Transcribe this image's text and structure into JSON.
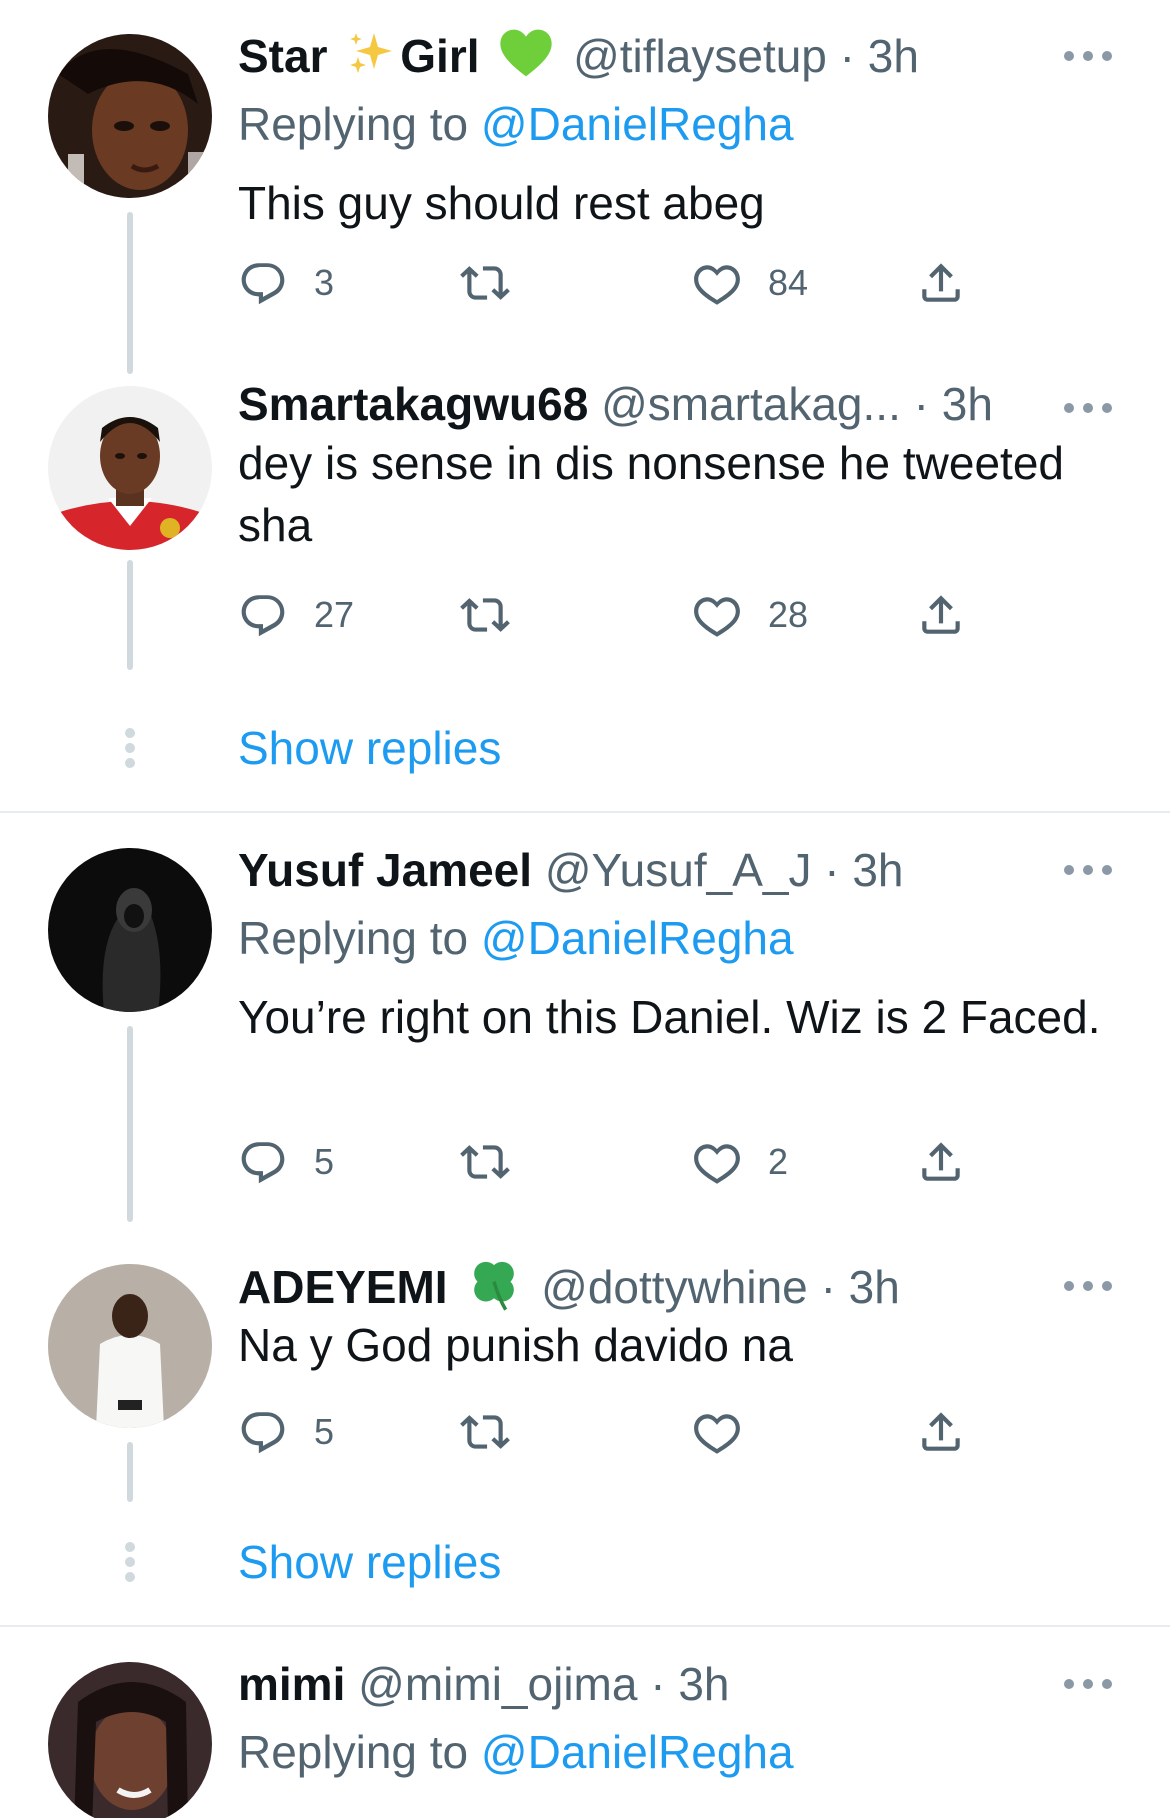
{
  "tweets": [
    {
      "name_part1": "Star",
      "name_part2": "Girl",
      "handle": "@tiflaysetup",
      "time": "· 3h",
      "replying_prefix": "Replying to",
      "replying_to": "@DanielRegha",
      "text": "This guy should rest abeg",
      "reply_count": "3",
      "retweet_count": "",
      "like_count": "84"
    },
    {
      "name": "Smartakagwu68",
      "handle": "@smartakag...",
      "time": "· 3h",
      "text": "dey is sense in dis nonsense he tweeted sha",
      "reply_count": "27",
      "retweet_count": "",
      "like_count": "28"
    },
    {
      "name": "Yusuf Jameel",
      "handle": "@Yusuf_A_J",
      "time": "· 3h",
      "replying_prefix": "Replying to",
      "replying_to": "@DanielRegha",
      "text": "You’re right on this Daniel. Wiz is 2 Faced.",
      "reply_count": "5",
      "retweet_count": "",
      "like_count": "2"
    },
    {
      "name": "ADEYEMI",
      "handle": "@dottywhine",
      "time": "· 3h",
      "text": "Na y God punish davido na",
      "reply_count": "5",
      "retweet_count": "",
      "like_count": ""
    },
    {
      "name": "mimi",
      "handle": "@mimi_ojima",
      "time": "· 3h",
      "replying_prefix": "Replying to",
      "replying_to": "@DanielRegha"
    }
  ],
  "show_replies_label": "Show replies",
  "icons": {
    "sparkles": "sparkles-icon",
    "green_heart": "green-heart-icon",
    "clover": "four-leaf-clover-icon",
    "reply": "reply-bubble-icon",
    "retweet": "retweet-icon",
    "like": "heart-icon",
    "share": "share-icon",
    "more": "more-dots-icon"
  },
  "colors": {
    "link": "#1d9bf0",
    "secondary_text": "#536471",
    "primary_text": "#0f1419",
    "thread_line": "#cfd9de"
  }
}
